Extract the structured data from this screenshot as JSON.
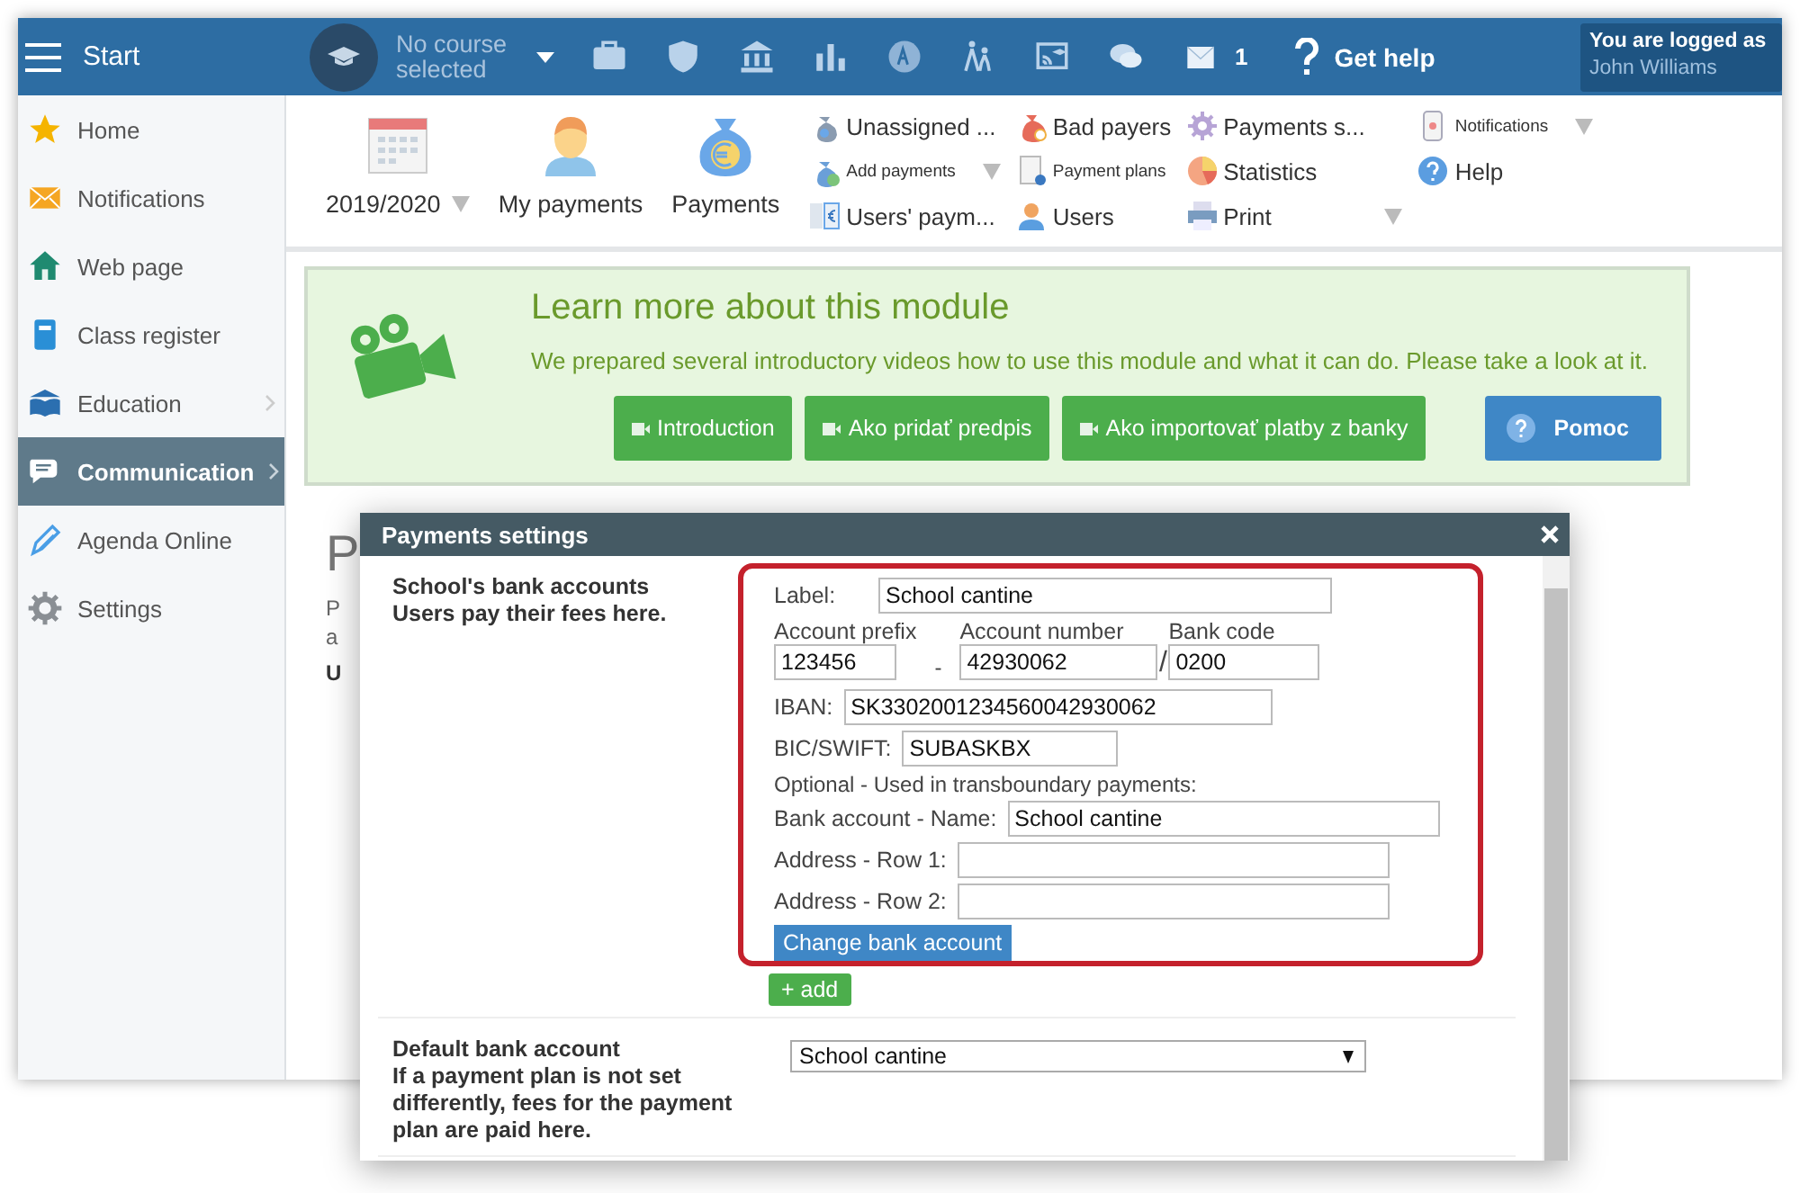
{
  "topbar": {
    "start": "Start",
    "course": "No course selected",
    "mail_count": "1",
    "help": "Get help",
    "login_label": "You are logged as",
    "user": "John Williams"
  },
  "sidebar": {
    "items": [
      {
        "label": "Home",
        "selected": false,
        "has_submenu": false
      },
      {
        "label": "Notifications",
        "selected": false,
        "has_submenu": false
      },
      {
        "label": "Web page",
        "selected": false,
        "has_submenu": false
      },
      {
        "label": "Class register",
        "selected": false,
        "has_submenu": false
      },
      {
        "label": "Education",
        "selected": false,
        "has_submenu": true
      },
      {
        "label": "Communication",
        "selected": true,
        "has_submenu": true
      },
      {
        "label": "Agenda Online",
        "selected": false,
        "has_submenu": false
      },
      {
        "label": "Settings",
        "selected": false,
        "has_submenu": false
      }
    ]
  },
  "toolbar": {
    "large": [
      {
        "label": "2019/2020",
        "has_dropdown": true
      },
      {
        "label": "My payments",
        "has_dropdown": false
      },
      {
        "label": "Payments",
        "has_dropdown": false
      }
    ],
    "columns": [
      [
        {
          "label": "Unassigned ...",
          "kind": "normal",
          "has_dropdown": false
        },
        {
          "label": "Add payments",
          "kind": "small",
          "has_dropdown": true
        },
        {
          "label": "Users' paym...",
          "kind": "normal",
          "has_dropdown": false
        }
      ],
      [
        {
          "label": "Bad payers",
          "kind": "normal",
          "has_dropdown": false
        },
        {
          "label": "Payment plans",
          "kind": "small",
          "has_dropdown": false
        },
        {
          "label": "Users",
          "kind": "normal",
          "has_dropdown": false
        }
      ],
      [
        {
          "label": "Payments s...",
          "kind": "normal",
          "has_dropdown": false
        },
        {
          "label": "Statistics",
          "kind": "normal",
          "has_dropdown": false
        },
        {
          "label": "Print",
          "kind": "normal",
          "has_dropdown": true
        }
      ],
      [
        {
          "label": "Notifications",
          "kind": "small",
          "has_dropdown": true
        },
        {
          "label": "Help",
          "kind": "normal",
          "has_dropdown": false
        }
      ]
    ]
  },
  "info": {
    "title": "Learn more about this module",
    "text": "We prepared several introductory videos how to use this module and what it can do. Please take a look at it.",
    "buttons": [
      {
        "label": "Introduction",
        "kind": "video"
      },
      {
        "label": "Ako pridať predpis",
        "kind": "video"
      },
      {
        "label": "Ako importovať platby z banky",
        "kind": "video"
      },
      {
        "label": "Pomoc",
        "kind": "help"
      }
    ]
  },
  "page": {
    "heading": "P",
    "lines": [
      "P",
      "a",
      "U"
    ]
  },
  "dialog": {
    "title": "Payments settings",
    "bank_section": {
      "label": "School's bank accounts",
      "note": "Users pay their fees here.",
      "label_field": {
        "label": "Label:",
        "value": "School cantine"
      },
      "prefix": {
        "label": "Account prefix",
        "value": "123456"
      },
      "prefix_separator": "-",
      "number": {
        "label": "Account number",
        "value": "42930062"
      },
      "code_separator": "/",
      "bank_code": {
        "label": "Bank code",
        "value": "0200"
      },
      "iban": {
        "label": "IBAN:",
        "value": "SK3302001234560042930062"
      },
      "bic": {
        "label": "BIC/SWIFT:",
        "value": "SUBASKBX"
      },
      "optional_note": "Optional - Used in transboundary payments:",
      "name": {
        "label": "Bank account - Name:",
        "value": "School cantine"
      },
      "address1": {
        "label": "Address - Row 1:"
      },
      "address2": {
        "label": "Address - Row 2:"
      },
      "change_button": "Change bank account",
      "add_button": "+ add"
    },
    "default_section": {
      "label": "Default bank account",
      "note": "If a payment plan is not set differently, fees for the payment plan are paid here.",
      "value": "School cantine"
    }
  }
}
